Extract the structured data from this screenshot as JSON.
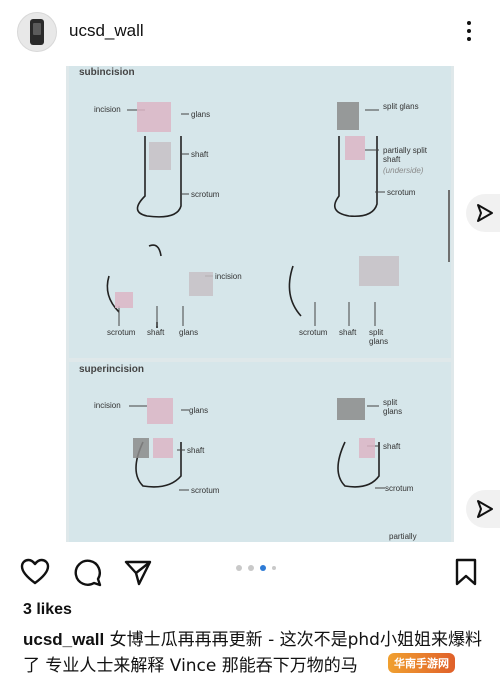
{
  "post": {
    "username": "ucsd_wall",
    "likes": "3 likes",
    "caption_user": "ucsd_wall",
    "caption_text": " 女博士瓜再再再更新 - 这次不是phd小姐姐来爆料了 专业人士来解释 Vince 那能吞下万物的马",
    "watermark": "华南手游网"
  },
  "media": {
    "panel1": {
      "title": "subincision",
      "labels": {
        "incision": "incision",
        "glans": "glans",
        "shaft": "shaft",
        "scrotum": "scrotum",
        "split_glans": "split glans",
        "partially_split_shaft": "partially split shaft",
        "underside": "(underside)",
        "scrotum_r": "scrotum",
        "incision_mid": "incision",
        "scrotum_bl": "scrotum",
        "shaft_bl": "shaft",
        "glans_bl": "glans",
        "scrotum_br": "scrotum",
        "shaft_br": "shaft",
        "split_glans_br": "split glans"
      }
    },
    "panel2": {
      "title": "superincision",
      "labels": {
        "incision": "incision",
        "glans": "glans",
        "shaft": "shaft",
        "scrotum": "scrotum",
        "split_glans": "split glans",
        "shaft_r": "shaft",
        "scrotum_r": "scrotum",
        "partially": "partially"
      }
    }
  },
  "carousel": {
    "count": 4,
    "active_index": 2
  },
  "icons": {
    "heart": "heart-icon",
    "comment": "comment-icon",
    "share": "share-icon",
    "save": "bookmark-icon",
    "more": "more-icon",
    "next": "send-icon"
  }
}
